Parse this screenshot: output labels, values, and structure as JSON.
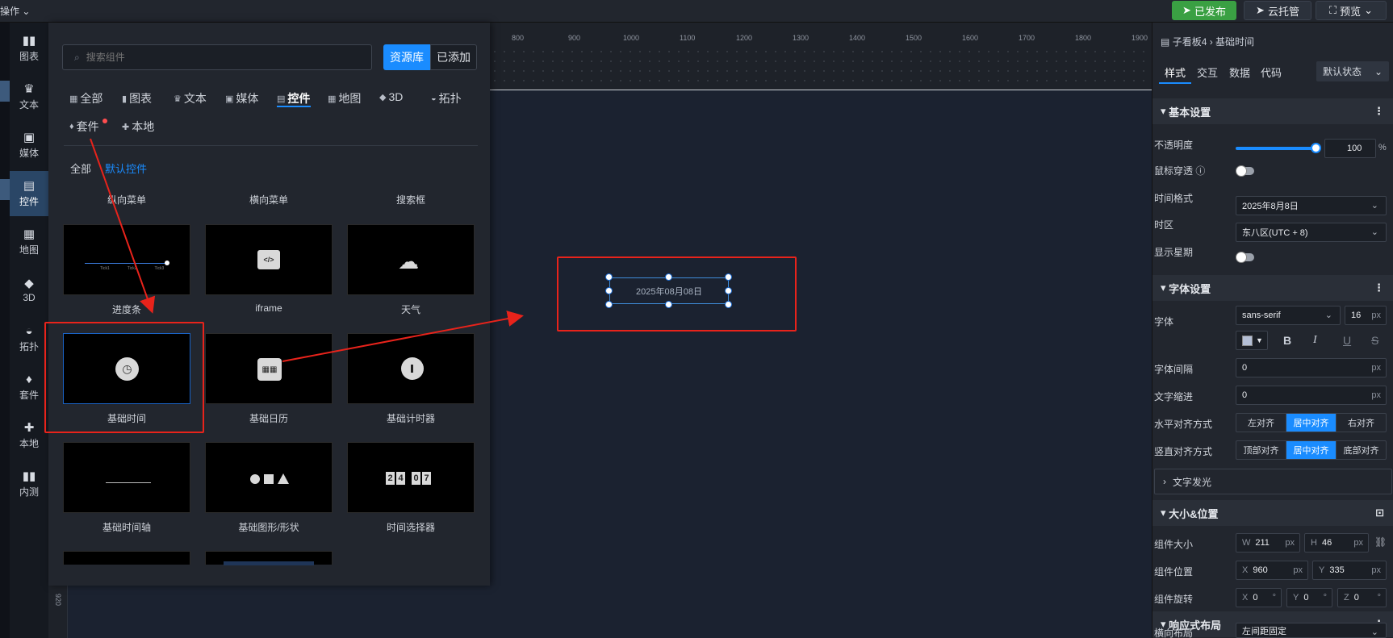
{
  "topbar": {
    "menu_label": "操作",
    "publish_label": "已发布",
    "cloud_label": "云托管",
    "preview_label": "预览"
  },
  "nav": [
    {
      "label": "图表",
      "icon": "chart-icon"
    },
    {
      "label": "文本",
      "icon": "text-icon"
    },
    {
      "label": "媒体",
      "icon": "media-icon"
    },
    {
      "label": "控件",
      "icon": "control-icon"
    },
    {
      "label": "地图",
      "icon": "map-icon"
    },
    {
      "label": "3D",
      "icon": "cube-icon"
    },
    {
      "label": "拓扑",
      "icon": "topology-icon"
    },
    {
      "label": "套件",
      "icon": "kit-icon"
    },
    {
      "label": "本地",
      "icon": "puzzle-icon"
    },
    {
      "label": "内测",
      "icon": "beta-icon"
    }
  ],
  "panel": {
    "search_placeholder": "搜索组件",
    "resource_label": "资源库",
    "added_label": "已添加",
    "categories": [
      "全部",
      "图表",
      "文本",
      "媒体",
      "控件",
      "地图",
      "3D",
      "拓扑",
      "套件",
      "本地"
    ],
    "sub_all": "全部",
    "sub_default": "默认控件",
    "top_labels": [
      "纵向菜单",
      "横向菜单",
      "搜索框"
    ],
    "cards": [
      {
        "label": "进度条"
      },
      {
        "label": "iframe"
      },
      {
        "label": "天气"
      },
      {
        "label": "基础时间"
      },
      {
        "label": "基础日历"
      },
      {
        "label": "基础计时器"
      },
      {
        "label": "基础时间轴"
      },
      {
        "label": "基础图形/形状"
      },
      {
        "label": "时间选择器"
      }
    ],
    "progress_ticks": [
      "Tick1",
      "Tick2",
      "Tick3"
    ],
    "picker_digits": [
      "2",
      "4",
      "0",
      "7"
    ]
  },
  "ruler_ticks": [
    "800",
    "900",
    "1000",
    "1100",
    "1200",
    "1300",
    "1400",
    "1500",
    "1600",
    "1700",
    "1800",
    "1900"
  ],
  "vruler_label": "920",
  "widget_text": "2025年08月08日",
  "right": {
    "crumb_parent": "子看板4",
    "crumb_current": "基础时间",
    "tabs": [
      "样式",
      "交互",
      "数据",
      "代码"
    ],
    "state": "默认状态",
    "basic_title": "基本设置",
    "opacity_label": "不透明度",
    "opacity_value": "100",
    "pct": "%",
    "mouse_label": "鼠标穿透",
    "timefmt_label": "时间格式",
    "timefmt_value": "2025年8月8日",
    "tz_label": "时区",
    "tz_value": "东八区(UTC + 8)",
    "week_label": "显示星期",
    "font_title": "字体设置",
    "font_label": "字体",
    "font_value": "sans-serif",
    "font_size": "16",
    "px": "px",
    "font_swatch": "#b4bfd6",
    "spacing_label": "字体间隔",
    "spacing_value": "0",
    "indent_label": "文字缩进",
    "indent_value": "0",
    "halign_label": "水平对齐方式",
    "halign": [
      "左对齐",
      "居中对齐",
      "右对齐"
    ],
    "valign_label": "竖直对齐方式",
    "valign": [
      "顶部对齐",
      "居中对齐",
      "底部对齐"
    ],
    "glow_label": "文字发光",
    "size_title": "大小&位置",
    "size_label": "组件大小",
    "w": "211",
    "h": "46",
    "pos_label": "组件位置",
    "x": "960",
    "y": "335",
    "rot_label": "组件旋转",
    "rx": "0",
    "ry": "0",
    "rz": "0",
    "deg": "°",
    "resp_title": "响应式布局",
    "hlayout_label": "横向布局",
    "hlayout_value": "左间距固定",
    "letter_w": "W",
    "letter_h": "H",
    "letter_x": "X",
    "letter_y": "Y",
    "letter_z": "Z"
  }
}
